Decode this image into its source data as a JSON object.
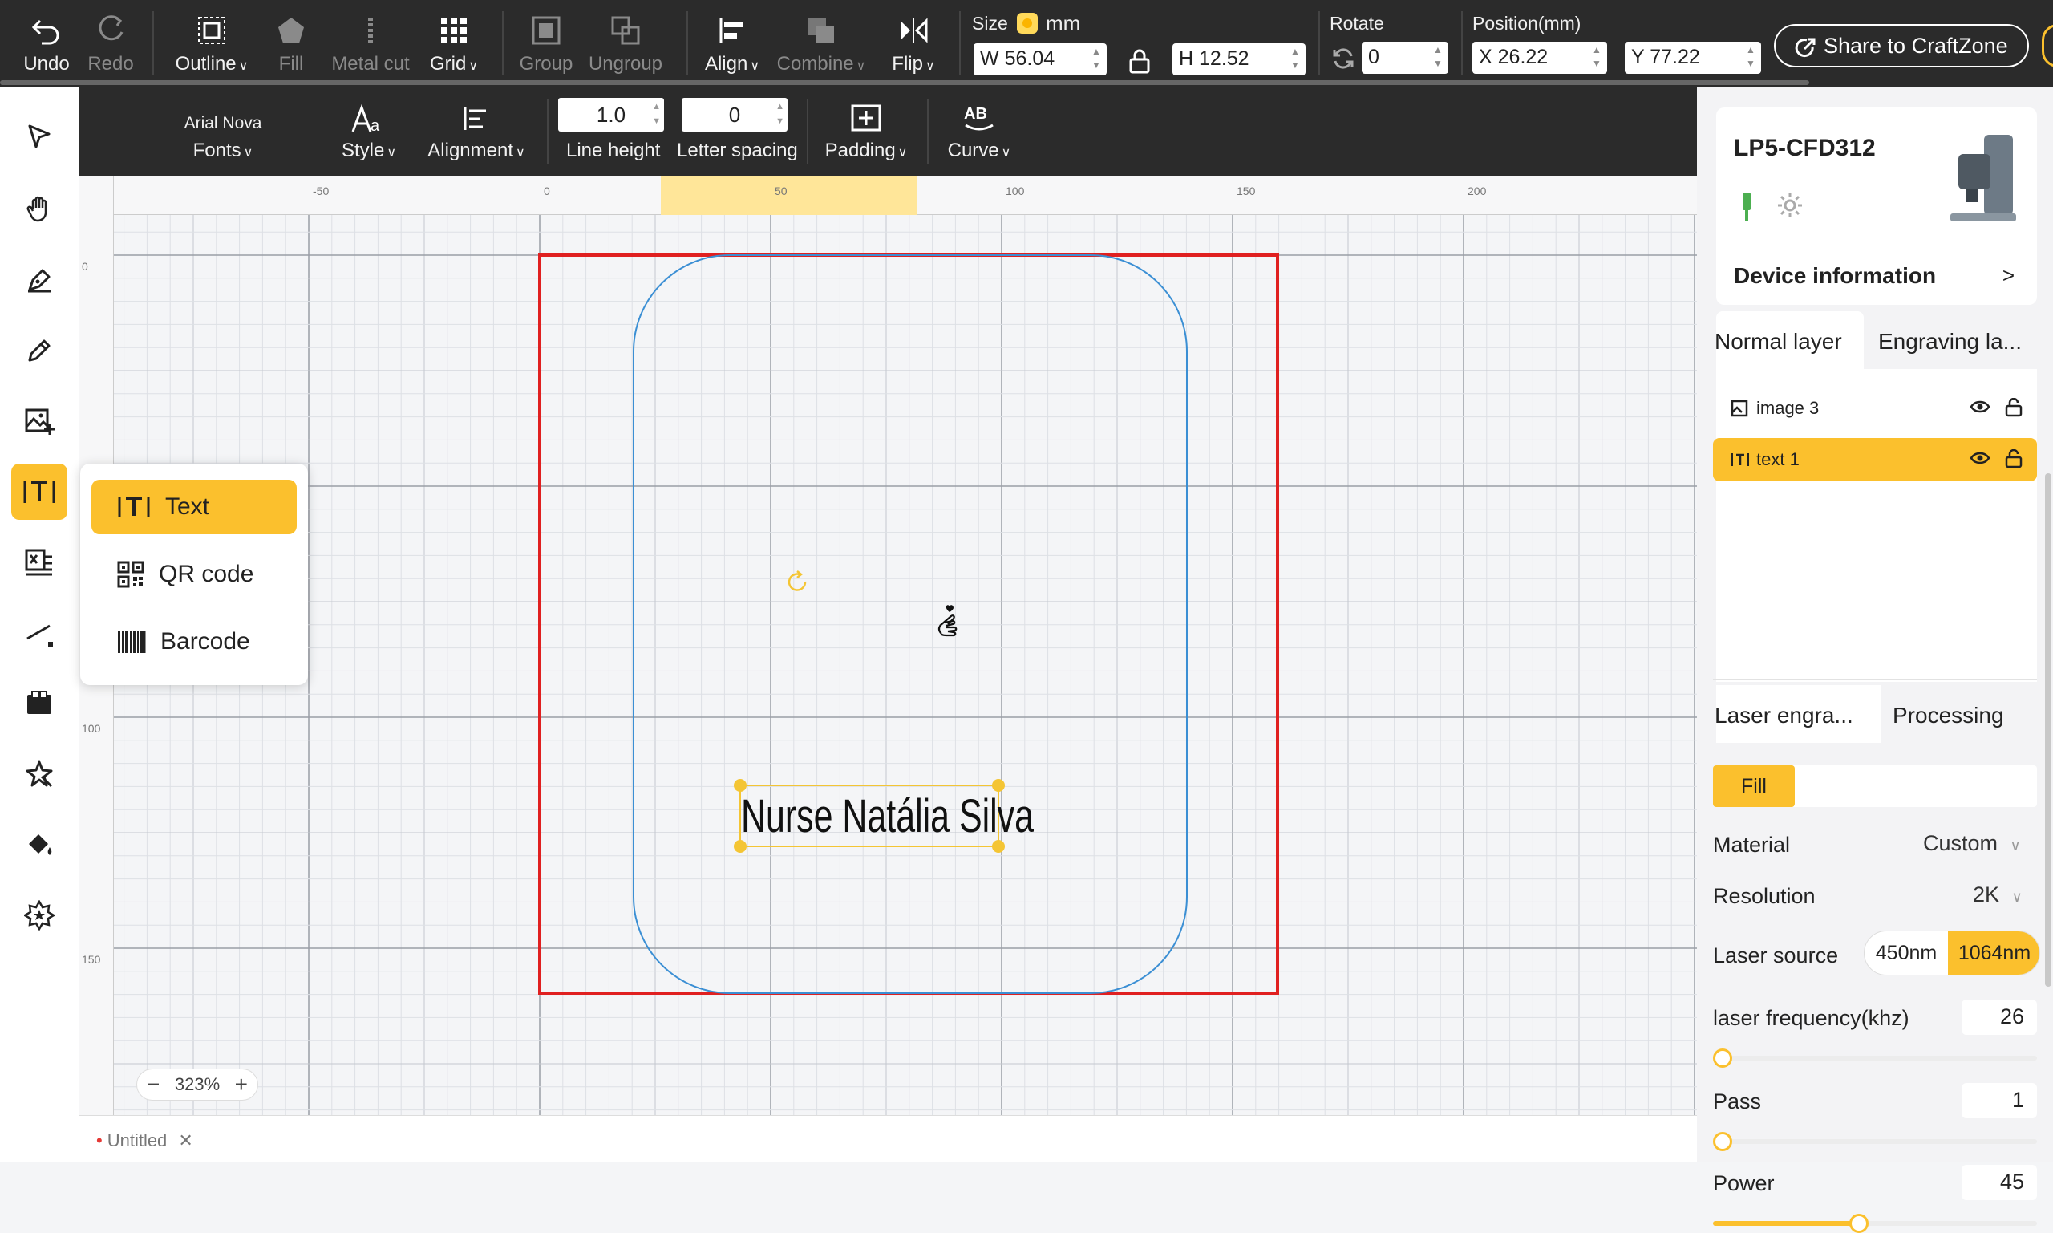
{
  "toolbar": {
    "undo": "Undo",
    "redo": "Redo",
    "outline": "Outline",
    "fill": "Fill",
    "metal_cut": "Metal cut",
    "grid": "Grid",
    "group": "Group",
    "ungroup": "Ungroup",
    "align": "Align",
    "combine": "Combine",
    "flip": "Flip",
    "size_label": "Size",
    "size_unit": "mm",
    "width_prefix": "W",
    "width": "56.04",
    "height_prefix": "H",
    "height": "12.52",
    "rotate_label": "Rotate",
    "rotate": "0",
    "position_label": "Position(mm)",
    "x_prefix": "X",
    "x": "26.22",
    "y_prefix": "Y",
    "y": "77.22",
    "share": "Share to CraftZone"
  },
  "text_toolbar": {
    "font_name": "Arial Nova",
    "fonts": "Fonts",
    "style": "Style",
    "alignment": "Alignment",
    "line_height_value": "1.0",
    "line_height": "Line height",
    "letter_spacing_value": "0",
    "letter_spacing": "Letter spacing",
    "padding": "Padding",
    "curve": "Curve"
  },
  "canvas": {
    "ruler_top": [
      "-50",
      "0",
      "50",
      "100",
      "150",
      "200"
    ],
    "ruler_left": [
      "0",
      "100",
      "150"
    ],
    "label_text": "Nurse Natália Silva",
    "zoom": "323%",
    "doc_tab": "Untitled"
  },
  "text_menu": {
    "items": [
      "Text",
      "QR code",
      "Barcode"
    ],
    "active": "Text"
  },
  "right_panel": {
    "device_name": "LP5-CFD312",
    "device_info": "Device information",
    "layer_tabs": [
      "Normal layer",
      "Engraving la..."
    ],
    "layers": [
      "image 3",
      "text 1"
    ],
    "process_tabs": [
      "Laser engra...",
      "Processing"
    ],
    "fill_chip": "Fill",
    "material_label": "Material",
    "material_value": "Custom",
    "resolution_label": "Resolution",
    "resolution_value": "2K",
    "laser_source_label": "Laser source",
    "laser_source_options": [
      "450nm",
      "1064nm"
    ],
    "laser_source_selected": "1064nm",
    "frequency_label": "laser frequency(khz)",
    "frequency_value": "26",
    "pass_label": "Pass",
    "pass_value": "1",
    "power_label": "Power",
    "power_value": "45",
    "power_fraction": 0.45
  },
  "colors": {
    "accent": "#fbc02d",
    "toolbar_bg": "#2b2b2b",
    "work_area": "#e02020",
    "outline_blue": "#3b8fd4"
  }
}
